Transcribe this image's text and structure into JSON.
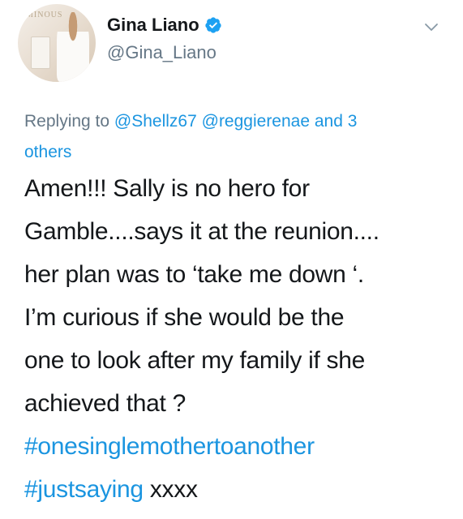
{
  "user": {
    "display_name": "Gina Liano",
    "handle": "@Gina_Liano",
    "verified": true,
    "avatar_text": "MINOUS"
  },
  "reply": {
    "prefix": "Replying to",
    "mentions": [
      "@Shellz67",
      "@reggierenae"
    ],
    "and_text": "and 3",
    "others_text": "others"
  },
  "body": {
    "lines": [
      "Amen!!! Sally is no hero for",
      "Gamble....says it at the reunion....",
      "her plan was to ‘take me down ‘.",
      "I’m curious if she would be the",
      "one to look after my family if she",
      "achieved that ?"
    ],
    "hashtags": [
      "#onesinglemothertoanother",
      "#justsaying"
    ],
    "suffix": "xxxx"
  },
  "icons": {
    "verified": "verified-badge-icon",
    "menu": "chevron-down-icon"
  },
  "colors": {
    "link": "#1b95e0",
    "secondary_text": "#657786",
    "primary_text": "#14171a"
  }
}
